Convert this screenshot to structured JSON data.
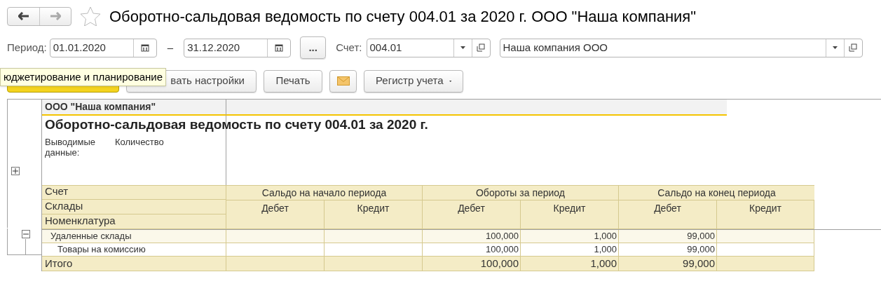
{
  "window": {
    "title": "Оборотно-сальдовая ведомость по счету 004.01 за 2020 г. ООО \"Наша компания\"",
    "favorite": false
  },
  "filters": {
    "period_label": "Период:",
    "date_from": "01.01.2020",
    "dash": "–",
    "date_to": "31.12.2020",
    "more_button": "...",
    "account_label": "Счет:",
    "account": "004.01",
    "organization": "Наша компания ООО"
  },
  "toolbar": [
    {
      "kind": "default"
    },
    {
      "kind": "plain",
      "label": "вать настройки"
    },
    {
      "kind": "plain",
      "label": "Печать"
    },
    {
      "kind": "mail"
    },
    {
      "kind": "menu",
      "label": "Регистр учета"
    }
  ],
  "tooltip": "юджетирование и планирование",
  "report": {
    "company": "ООО \"Наша компания\"",
    "title": "Оборотно-сальдовая ведомость по счету 004.01 за 2020 г.",
    "param_label": "Выводимые данные:",
    "param_value": "Количество",
    "header_expanded": false,
    "header_rows": [
      "Счет",
      "Склады",
      "Номенклатура"
    ],
    "column_groups": [
      {
        "label": "Сальдо на начало периода",
        "columns": [
          "Дебет",
          "Кредит"
        ]
      },
      {
        "label": "Обороты за период",
        "columns": [
          "Дебет",
          "Кредит"
        ]
      },
      {
        "label": "Сальдо на конец периода",
        "columns": [
          "Дебет",
          "Кредит"
        ]
      }
    ],
    "rows": [
      {
        "kind": "group",
        "expanded": true,
        "label": "Удаленные склады",
        "cells": [
          null,
          null,
          "100,000",
          "1,000",
          "99,000",
          null
        ]
      },
      {
        "kind": "item",
        "label": "Товары на комиссию",
        "cells": [
          null,
          null,
          "100,000",
          "1,000",
          "99,000",
          null
        ]
      },
      {
        "kind": "total",
        "label": "Итого",
        "cells": [
          null,
          null,
          "100,000",
          "1,000",
          "99,000",
          null
        ]
      }
    ]
  }
}
